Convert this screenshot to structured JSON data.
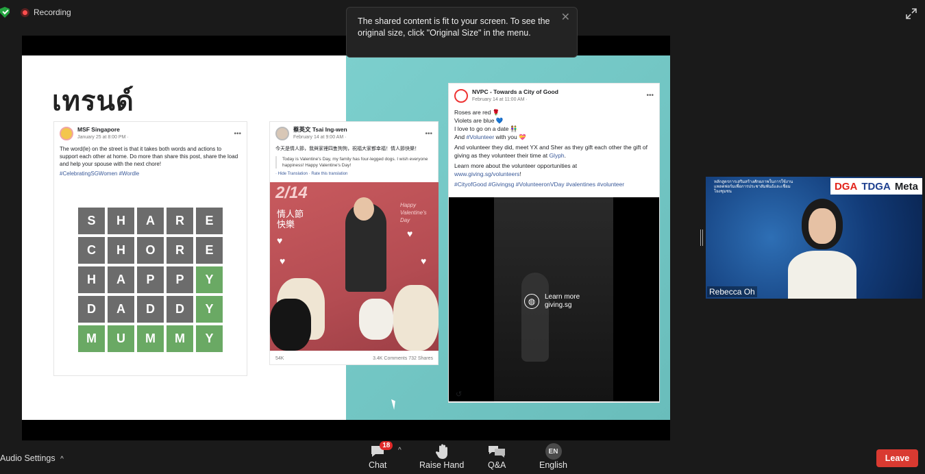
{
  "topbar": {
    "recording_label": "Recording"
  },
  "toast": {
    "message": "The shared content is fit to your screen. To see the original size, click \"Original Size\" in the menu.",
    "close": "✕"
  },
  "slide": {
    "title": "เทรนด์",
    "post_msf": {
      "name": "MSF Singapore",
      "date": "January 25 at 8:00 PM · ",
      "text": "The word(le) on the street is that it takes both words and actions to support each other at home. Do more than share this post, share the load and help your spouse with the next chore!",
      "tags": "#CelebratingSGWomen #Wordle",
      "wordle": [
        [
          {
            "l": "S",
            "c": "gray"
          },
          {
            "l": "H",
            "c": "gray"
          },
          {
            "l": "A",
            "c": "gray"
          },
          {
            "l": "R",
            "c": "gray"
          },
          {
            "l": "E",
            "c": "gray"
          }
        ],
        [
          {
            "l": "C",
            "c": "gray"
          },
          {
            "l": "H",
            "c": "gray"
          },
          {
            "l": "O",
            "c": "gray"
          },
          {
            "l": "R",
            "c": "gray"
          },
          {
            "l": "E",
            "c": "gray"
          }
        ],
        [
          {
            "l": "H",
            "c": "gray"
          },
          {
            "l": "A",
            "c": "gray"
          },
          {
            "l": "P",
            "c": "gray"
          },
          {
            "l": "P",
            "c": "gray"
          },
          {
            "l": "Y",
            "c": "green"
          }
        ],
        [
          {
            "l": "D",
            "c": "gray"
          },
          {
            "l": "A",
            "c": "gray"
          },
          {
            "l": "D",
            "c": "gray"
          },
          {
            "l": "D",
            "c": "gray"
          },
          {
            "l": "Y",
            "c": "green"
          }
        ],
        [
          {
            "l": "M",
            "c": "green"
          },
          {
            "l": "U",
            "c": "green"
          },
          {
            "l": "M",
            "c": "green"
          },
          {
            "l": "M",
            "c": "green"
          },
          {
            "l": "Y",
            "c": "green"
          }
        ]
      ]
    },
    "post_tsai": {
      "name": "蔡英文 Tsai Ing-wen",
      "date": "February 14 at 9:00 AM · ",
      "text": "今天是情人節，我與家裡四隻狗狗，祝福大家都幸福！情人節快樂！",
      "translation": "Today is Valentine's Day, my family has four-legged dogs. I wish everyone happiness! Happy Valentine's Day!",
      "translation_links": "· Hide Translation · Rate this translation",
      "image_big": "2/14",
      "image_cn": "情人節\n快樂",
      "image_en": "Happy Valentine's Day",
      "reactions": "54K",
      "stats": "3.4K Comments  732 Shares"
    },
    "post_nvpc": {
      "name": "NVPC - Towards a City of Good",
      "date": "February 14 at 11:00 AM · ",
      "line1": "Roses are red 🌹",
      "line2": "Violets are blue 💙",
      "line3": "I love to go on a date 👫",
      "line4_pre": "And ",
      "line4_link": "#Volunteer",
      "line4_post": " with you 💝",
      "para2_pre": "And volunteer they did, meet YX and Sher as they gift each other the gift of giving as they volunteer their time at ",
      "para2_link": "Glyph",
      "para2_post": ".",
      "para3": "Learn more about the volunteer opportunities at",
      "url": "www.giving.sg/volunteers",
      "url_post": "!",
      "tags": "#CityofGood #Givingsg #VolunteeronVDay #valentines #volunteer",
      "video_cta": "Learn more\ngiving.sg",
      "replay_icon": "↺"
    },
    "controls": [
      "arrow-left",
      "pointer",
      "cc",
      "more",
      "arrow-right"
    ]
  },
  "participant": {
    "name": "Rebecca Oh",
    "banner_thai": "หลักสูตรการเสริมสร้างศักยภาพในการใช้งานแพลตฟอร์มเพื่อการประชาสัมพันธ์และเชื่อมโยงชุมชน",
    "logos": [
      "DGA",
      "TDGA",
      "Meta"
    ]
  },
  "toolbar": {
    "audio_settings": "Audio Settings",
    "chat": "Chat",
    "chat_badge": "18",
    "raise_hand": "Raise Hand",
    "qa": "Q&A",
    "language_code": "EN",
    "language": "English",
    "leave": "Leave"
  },
  "colors": {
    "leave": "#d93a31",
    "badge": "#e02828",
    "wordle_green": "#6aa964",
    "wordle_gray": "#6c6c6c",
    "teal": "#74c6c4"
  }
}
